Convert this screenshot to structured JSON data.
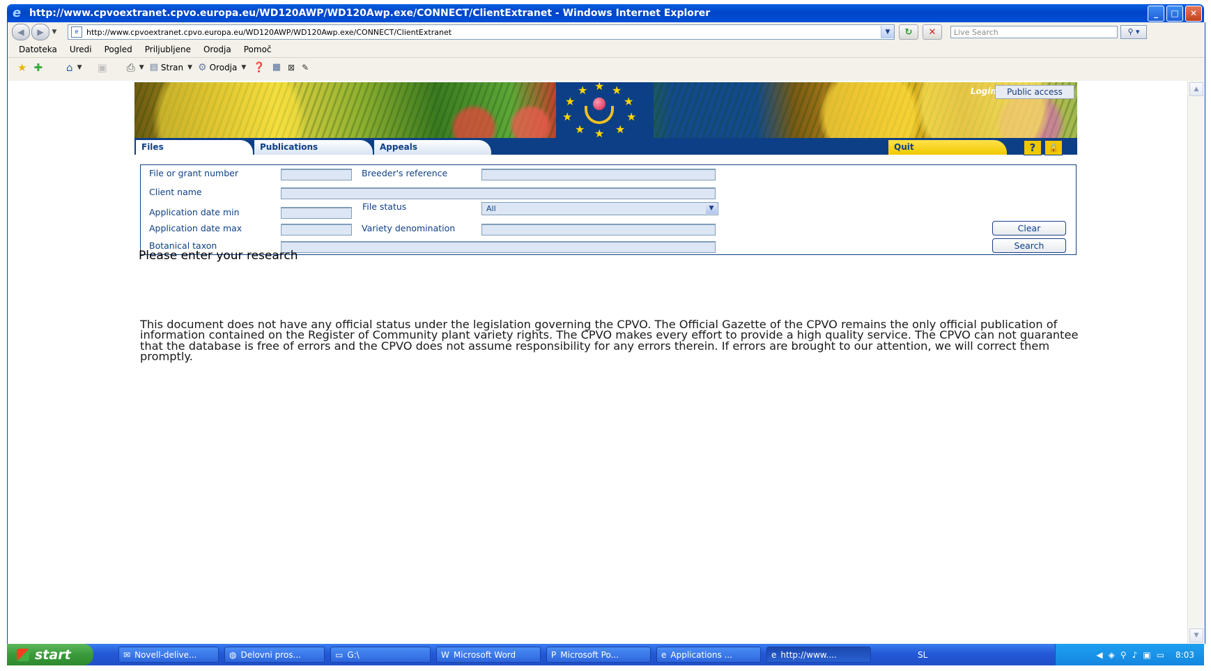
{
  "window": {
    "title": "http://www.cpvoextranet.cpvo.europa.eu/WD120AWP/WD120Awp.exe/CONNECT/ClientExtranet - Windows Internet Explorer",
    "minimize": "_",
    "maximize": "□",
    "close": "✕"
  },
  "address_bar": {
    "url": "http://www.cpvoextranet.cpvo.europa.eu/WD120AWP/WD120Awp.exe/CONNECT/ClientExtranet",
    "search_placeholder": "Live Search"
  },
  "menu": [
    "Datoteka",
    "Uredi",
    "Pogled",
    "Priljubljene",
    "Orodja",
    "Pomoč"
  ],
  "toolbar": {
    "page_label": "Stran",
    "tools_label": "Orodja"
  },
  "site": {
    "login_label": "Login",
    "public_access": "Public access",
    "tabs": {
      "files": "Files",
      "publications": "Publications",
      "appeals": "Appeals",
      "quit": "Quit"
    },
    "help_icon": "?",
    "lock_icon": "🔒"
  },
  "form": {
    "labels": {
      "file_grant": "File or grant number",
      "breeder_ref": "Breeder's reference",
      "client_name": "Client name",
      "app_date_min": "Application date min",
      "file_status": "File status",
      "app_date_max": "Application date max",
      "variety_denomination": "Variety denomination",
      "botanical_taxon": "Botanical taxon"
    },
    "file_status_value": "All",
    "clear_button": "Clear",
    "search_button": "Search"
  },
  "message": "Please enter your research",
  "disclaimer": "This document does not have any official status under the legislation governing the CPVO. The Official Gazette of the CPVO remains the only official publication of information contained on the Register of Community plant variety rights. The CPVO makes every effort to provide a high quality service. The CPVO can not guarantee that the database is free of errors and the CPVO does not assume responsibility for any errors therein. If errors are brought to our attention, we will correct them promptly.",
  "taskbar": {
    "start": "start",
    "items": [
      "Novell-delive...",
      "Delovni pros...",
      "G:\\",
      "Microsoft Word",
      "Microsoft Po...",
      "Applications ...",
      "http://www...."
    ],
    "language": "SL",
    "clock": "8:03"
  }
}
